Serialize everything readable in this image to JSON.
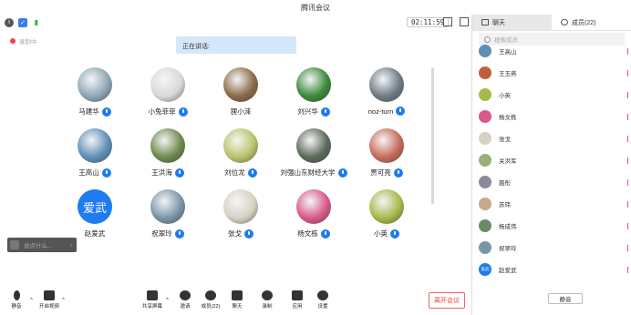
{
  "window": {
    "title": "腾讯会议"
  },
  "topbar": {
    "timer": "02:11:59"
  },
  "recording": {
    "label": "录制中"
  },
  "speaking": {
    "label": "正在讲话:"
  },
  "participants": [
    {
      "name": "马建华",
      "mic": true,
      "color": "#8fa7b8"
    },
    {
      "name": "小兔菲菲",
      "mic": true,
      "color": "#d9d9d9"
    },
    {
      "name": "狸小淶",
      "mic": false,
      "color": "#8a6b4a"
    },
    {
      "name": "刘兴华",
      "mic": true,
      "color": "#3c8a3c"
    },
    {
      "name": "noz-turn",
      "mic": true,
      "color": "#6f7c86"
    },
    {
      "name": "王高山",
      "mic": true,
      "color": "#5f8fb8"
    },
    {
      "name": "王洪海",
      "mic": true,
      "color": "#6e8a4e"
    },
    {
      "name": "刘位龙",
      "mic": true,
      "color": "#b9c46a"
    },
    {
      "name": "刘强山东财经大学",
      "mic": true,
      "color": "#5b6b5a"
    },
    {
      "name": "贾可亮",
      "mic": true,
      "color": "#c76c5a"
    },
    {
      "name": "赵爱武",
      "mic": false,
      "avatar_text": "爱武"
    },
    {
      "name": "祝翠玲",
      "mic": true,
      "color": "#7a95a8"
    },
    {
      "name": "张戈",
      "mic": true,
      "color": "#d8d2c4"
    },
    {
      "name": "杨文栋",
      "mic": true,
      "color": "#d85a8a"
    },
    {
      "name": "小英",
      "mic": true,
      "color": "#a9b84a"
    }
  ],
  "chatbox": {
    "placeholder": "说点什么..."
  },
  "toolbar": {
    "mute": "静音",
    "video": "开启视频",
    "share": "共享屏幕",
    "invite": "邀请",
    "members": "成员(22)",
    "chat": "聊天",
    "record": "录制",
    "apps": "应用",
    "settings": "设置",
    "leave": "离开会议"
  },
  "panel": {
    "tab_chat": "聊天",
    "tab_members": "成员(22)",
    "search_placeholder": "搜索成员",
    "mute_all": "静音",
    "members": [
      {
        "name": "王高山",
        "color": "#5f8fb8"
      },
      {
        "name": "王玉燕",
        "color": "#c0603a"
      },
      {
        "name": "小英",
        "color": "#a9b84a"
      },
      {
        "name": "杨文栋",
        "color": "#d85a8a"
      },
      {
        "name": "张戈",
        "color": "#d8d2c4"
      },
      {
        "name": "关洪军",
        "color": "#9ab07a"
      },
      {
        "name": "聂彤",
        "color": "#8a8a9a"
      },
      {
        "name": "苏玮",
        "color": "#c7a98a"
      },
      {
        "name": "杨成伟",
        "color": "#6a8a6a"
      },
      {
        "name": "祝翠玲",
        "color": "#7a95a8"
      },
      {
        "name": "赵爱武",
        "avatar_text": "爱武"
      }
    ]
  }
}
